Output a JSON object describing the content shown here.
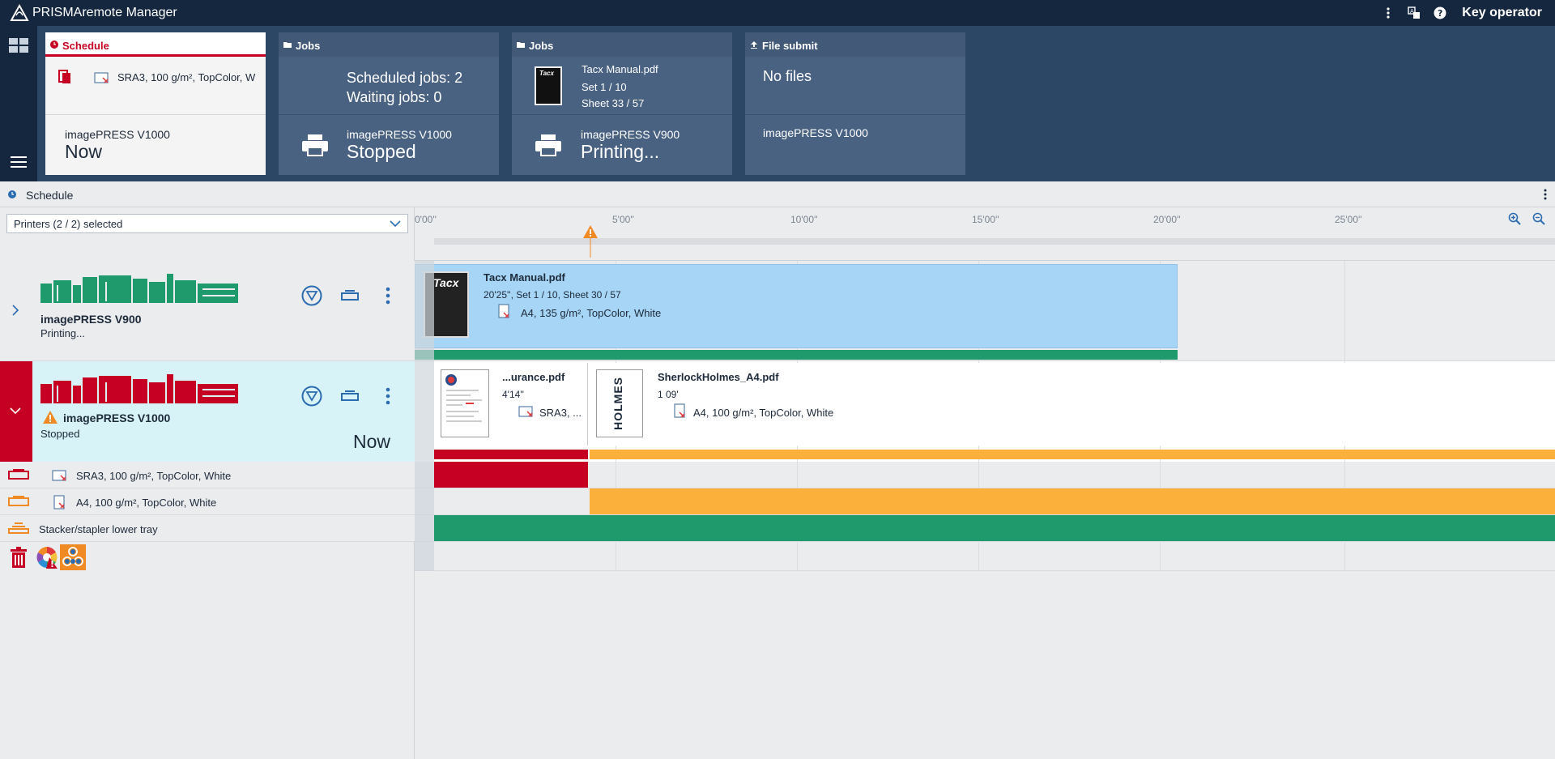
{
  "app": {
    "title": "PRISMAremote Manager",
    "user_role": "Key operator"
  },
  "dashboard": {
    "schedule_tile": {
      "header": "Schedule",
      "media": "SRA3, 100 g/m², TopColor, W",
      "printer": "imagePRESS V1000",
      "time": "Now"
    },
    "jobs_tile_1": {
      "header": "Jobs",
      "scheduled": "Scheduled jobs: 2",
      "waiting": "Waiting jobs: 0",
      "printer": "imagePRESS V1000",
      "status": "Stopped"
    },
    "jobs_tile_2": {
      "header": "Jobs",
      "file": "Tacx Manual.pdf",
      "set": "Set 1 / 10",
      "sheet": "Sheet 33 / 57",
      "printer": "imagePRESS V900",
      "status": "Printing..."
    },
    "file_submit_tile": {
      "header": "File submit",
      "content": "No files",
      "printer": "imagePRESS V1000"
    }
  },
  "schedule_bar": {
    "label": "Schedule"
  },
  "left_panel": {
    "printer_select": "Printers (2 / 2) selected",
    "printers": [
      {
        "name": "imagePRESS V900",
        "status": "Printing...",
        "color": "#1f9a6c"
      },
      {
        "name": "imagePRESS V1000",
        "status": "Stopped",
        "time": "Now",
        "color": "#c60022"
      }
    ],
    "media_rows": [
      {
        "label": "SRA3, 100 g/m², TopColor, White",
        "tray_color": "#c60022"
      },
      {
        "label": "A4, 100 g/m², TopColor, White",
        "tray_color": "#f08a24"
      },
      {
        "label": "Stacker/stapler lower tray",
        "tray_color": "#f08a24"
      }
    ]
  },
  "timeline": {
    "ticks": [
      "0'00''",
      "5'00''",
      "10'00''",
      "15'00''",
      "20'00''",
      "25'00''"
    ],
    "jobs": {
      "tacx": {
        "title": "Tacx Manual.pdf",
        "info": "20'25'', Set 1 / 10, Sheet 30 / 57",
        "media": "A4, 135 g/m², TopColor, White",
        "thumb_text": "Tacx"
      },
      "insurance": {
        "title": "...urance.pdf",
        "duration": "4'14''",
        "media": "SRA3, ..."
      },
      "sherlock": {
        "title": "SherlockHolmes_A4.pdf",
        "duration": "1 09'",
        "media": "A4, 100 g/m², TopColor, White",
        "thumb_text": "HOLMES"
      }
    },
    "colors": {
      "green": "#1f9a6c",
      "red": "#c60022",
      "orange": "#fbb03b",
      "blue": "#a6d5f6"
    }
  }
}
